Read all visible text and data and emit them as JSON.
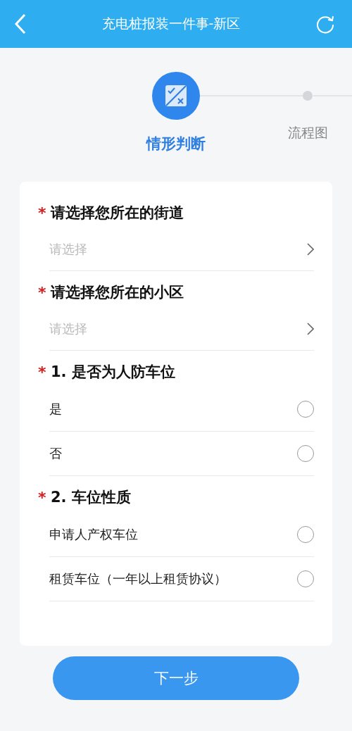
{
  "header": {
    "title": "充电桩报装一件事-新区"
  },
  "steps": [
    {
      "label": "情形判断",
      "selected": true
    },
    {
      "label": "流程图",
      "selected": false
    }
  ],
  "questions": [
    {
      "kind": "select",
      "marker": "*",
      "label": "请选择您所在的街道",
      "placeholder": "请选择"
    },
    {
      "kind": "select",
      "marker": "*",
      "label": "请选择您所在的小区",
      "placeholder": "请选择"
    },
    {
      "kind": "radio",
      "marker": "*",
      "label": "1. 是否为人防车位",
      "options": [
        {
          "label": "是",
          "selected": false
        },
        {
          "label": "否",
          "selected": false
        }
      ]
    },
    {
      "kind": "radio",
      "marker": "*",
      "label": "2. 车位性质",
      "options": [
        {
          "label": "申请人产权车位",
          "selected": false
        },
        {
          "label": "租赁车位（一年以上租赁协议）",
          "selected": false
        }
      ]
    }
  ],
  "next_button": "下一步"
}
